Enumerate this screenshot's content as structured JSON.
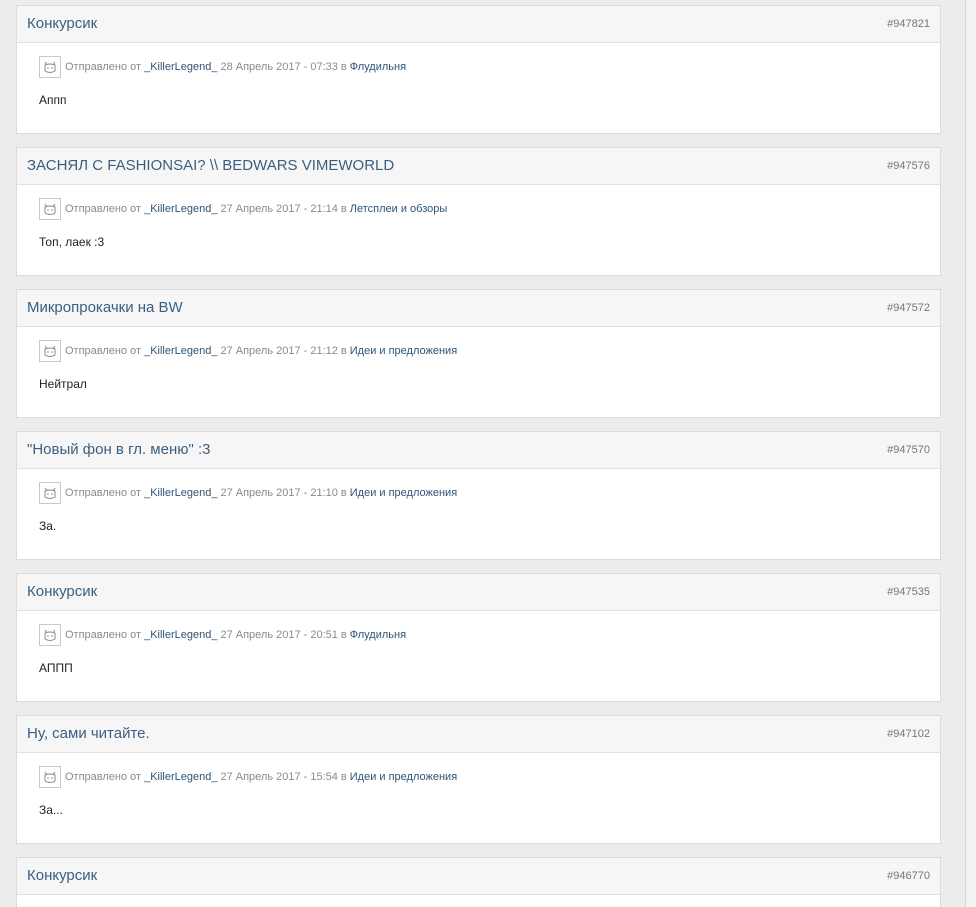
{
  "labels": {
    "sent_by": "Отправлено от",
    "in": "в"
  },
  "posts": [
    {
      "title": "Конкурсик",
      "id": "#947821",
      "author": "_KillerLegend_",
      "date": "28 Апрель 2017 - 07:33",
      "forum": "Флудильня",
      "text": "Аппп"
    },
    {
      "title": "ЗАСНЯЛ С FASHIONSAI? \\\\ BEDWARS VIMEWORLD",
      "id": "#947576",
      "author": "_KillerLegend_",
      "date": "27 Апрель 2017 - 21:14",
      "forum": "Летсплеи и обзоры",
      "text": "Топ, лаек :3"
    },
    {
      "title": "Микропрокачки на BW",
      "id": "#947572",
      "author": "_KillerLegend_",
      "date": "27 Апрель 2017 - 21:12",
      "forum": "Идеи и предложения",
      "text": "Нейтрал"
    },
    {
      "title": "\"Новый фон в гл. меню\" :3",
      "id": "#947570",
      "author": "_KillerLegend_",
      "date": "27 Апрель 2017 - 21:10",
      "forum": "Идеи и предложения",
      "text": "За."
    },
    {
      "title": "Конкурсик",
      "id": "#947535",
      "author": "_KillerLegend_",
      "date": "27 Апрель 2017 - 20:51",
      "forum": "Флудильня",
      "text": "АППП"
    },
    {
      "title": "Ну, сами читайте.",
      "id": "#947102",
      "author": "_KillerLegend_",
      "date": "27 Апрель 2017 - 15:54",
      "forum": "Идеи и предложения",
      "text": "За..."
    },
    {
      "title": "Конкурсик",
      "id": "#946770"
    }
  ]
}
